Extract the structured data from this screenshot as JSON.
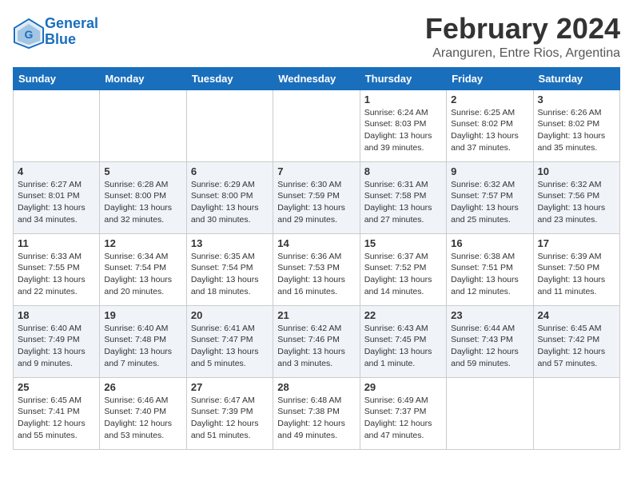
{
  "header": {
    "logo_line1": "General",
    "logo_line2": "Blue",
    "month": "February 2024",
    "location": "Aranguren, Entre Rios, Argentina"
  },
  "days_of_week": [
    "Sunday",
    "Monday",
    "Tuesday",
    "Wednesday",
    "Thursday",
    "Friday",
    "Saturday"
  ],
  "weeks": [
    [
      {
        "day": "",
        "info": ""
      },
      {
        "day": "",
        "info": ""
      },
      {
        "day": "",
        "info": ""
      },
      {
        "day": "",
        "info": ""
      },
      {
        "day": "1",
        "info": "Sunrise: 6:24 AM\nSunset: 8:03 PM\nDaylight: 13 hours and 39 minutes."
      },
      {
        "day": "2",
        "info": "Sunrise: 6:25 AM\nSunset: 8:02 PM\nDaylight: 13 hours and 37 minutes."
      },
      {
        "day": "3",
        "info": "Sunrise: 6:26 AM\nSunset: 8:02 PM\nDaylight: 13 hours and 35 minutes."
      }
    ],
    [
      {
        "day": "4",
        "info": "Sunrise: 6:27 AM\nSunset: 8:01 PM\nDaylight: 13 hours and 34 minutes."
      },
      {
        "day": "5",
        "info": "Sunrise: 6:28 AM\nSunset: 8:00 PM\nDaylight: 13 hours and 32 minutes."
      },
      {
        "day": "6",
        "info": "Sunrise: 6:29 AM\nSunset: 8:00 PM\nDaylight: 13 hours and 30 minutes."
      },
      {
        "day": "7",
        "info": "Sunrise: 6:30 AM\nSunset: 7:59 PM\nDaylight: 13 hours and 29 minutes."
      },
      {
        "day": "8",
        "info": "Sunrise: 6:31 AM\nSunset: 7:58 PM\nDaylight: 13 hours and 27 minutes."
      },
      {
        "day": "9",
        "info": "Sunrise: 6:32 AM\nSunset: 7:57 PM\nDaylight: 13 hours and 25 minutes."
      },
      {
        "day": "10",
        "info": "Sunrise: 6:32 AM\nSunset: 7:56 PM\nDaylight: 13 hours and 23 minutes."
      }
    ],
    [
      {
        "day": "11",
        "info": "Sunrise: 6:33 AM\nSunset: 7:55 PM\nDaylight: 13 hours and 22 minutes."
      },
      {
        "day": "12",
        "info": "Sunrise: 6:34 AM\nSunset: 7:54 PM\nDaylight: 13 hours and 20 minutes."
      },
      {
        "day": "13",
        "info": "Sunrise: 6:35 AM\nSunset: 7:54 PM\nDaylight: 13 hours and 18 minutes."
      },
      {
        "day": "14",
        "info": "Sunrise: 6:36 AM\nSunset: 7:53 PM\nDaylight: 13 hours and 16 minutes."
      },
      {
        "day": "15",
        "info": "Sunrise: 6:37 AM\nSunset: 7:52 PM\nDaylight: 13 hours and 14 minutes."
      },
      {
        "day": "16",
        "info": "Sunrise: 6:38 AM\nSunset: 7:51 PM\nDaylight: 13 hours and 12 minutes."
      },
      {
        "day": "17",
        "info": "Sunrise: 6:39 AM\nSunset: 7:50 PM\nDaylight: 13 hours and 11 minutes."
      }
    ],
    [
      {
        "day": "18",
        "info": "Sunrise: 6:40 AM\nSunset: 7:49 PM\nDaylight: 13 hours and 9 minutes."
      },
      {
        "day": "19",
        "info": "Sunrise: 6:40 AM\nSunset: 7:48 PM\nDaylight: 13 hours and 7 minutes."
      },
      {
        "day": "20",
        "info": "Sunrise: 6:41 AM\nSunset: 7:47 PM\nDaylight: 13 hours and 5 minutes."
      },
      {
        "day": "21",
        "info": "Sunrise: 6:42 AM\nSunset: 7:46 PM\nDaylight: 13 hours and 3 minutes."
      },
      {
        "day": "22",
        "info": "Sunrise: 6:43 AM\nSunset: 7:45 PM\nDaylight: 13 hours and 1 minute."
      },
      {
        "day": "23",
        "info": "Sunrise: 6:44 AM\nSunset: 7:43 PM\nDaylight: 12 hours and 59 minutes."
      },
      {
        "day": "24",
        "info": "Sunrise: 6:45 AM\nSunset: 7:42 PM\nDaylight: 12 hours and 57 minutes."
      }
    ],
    [
      {
        "day": "25",
        "info": "Sunrise: 6:45 AM\nSunset: 7:41 PM\nDaylight: 12 hours and 55 minutes."
      },
      {
        "day": "26",
        "info": "Sunrise: 6:46 AM\nSunset: 7:40 PM\nDaylight: 12 hours and 53 minutes."
      },
      {
        "day": "27",
        "info": "Sunrise: 6:47 AM\nSunset: 7:39 PM\nDaylight: 12 hours and 51 minutes."
      },
      {
        "day": "28",
        "info": "Sunrise: 6:48 AM\nSunset: 7:38 PM\nDaylight: 12 hours and 49 minutes."
      },
      {
        "day": "29",
        "info": "Sunrise: 6:49 AM\nSunset: 7:37 PM\nDaylight: 12 hours and 47 minutes."
      },
      {
        "day": "",
        "info": ""
      },
      {
        "day": "",
        "info": ""
      }
    ]
  ]
}
